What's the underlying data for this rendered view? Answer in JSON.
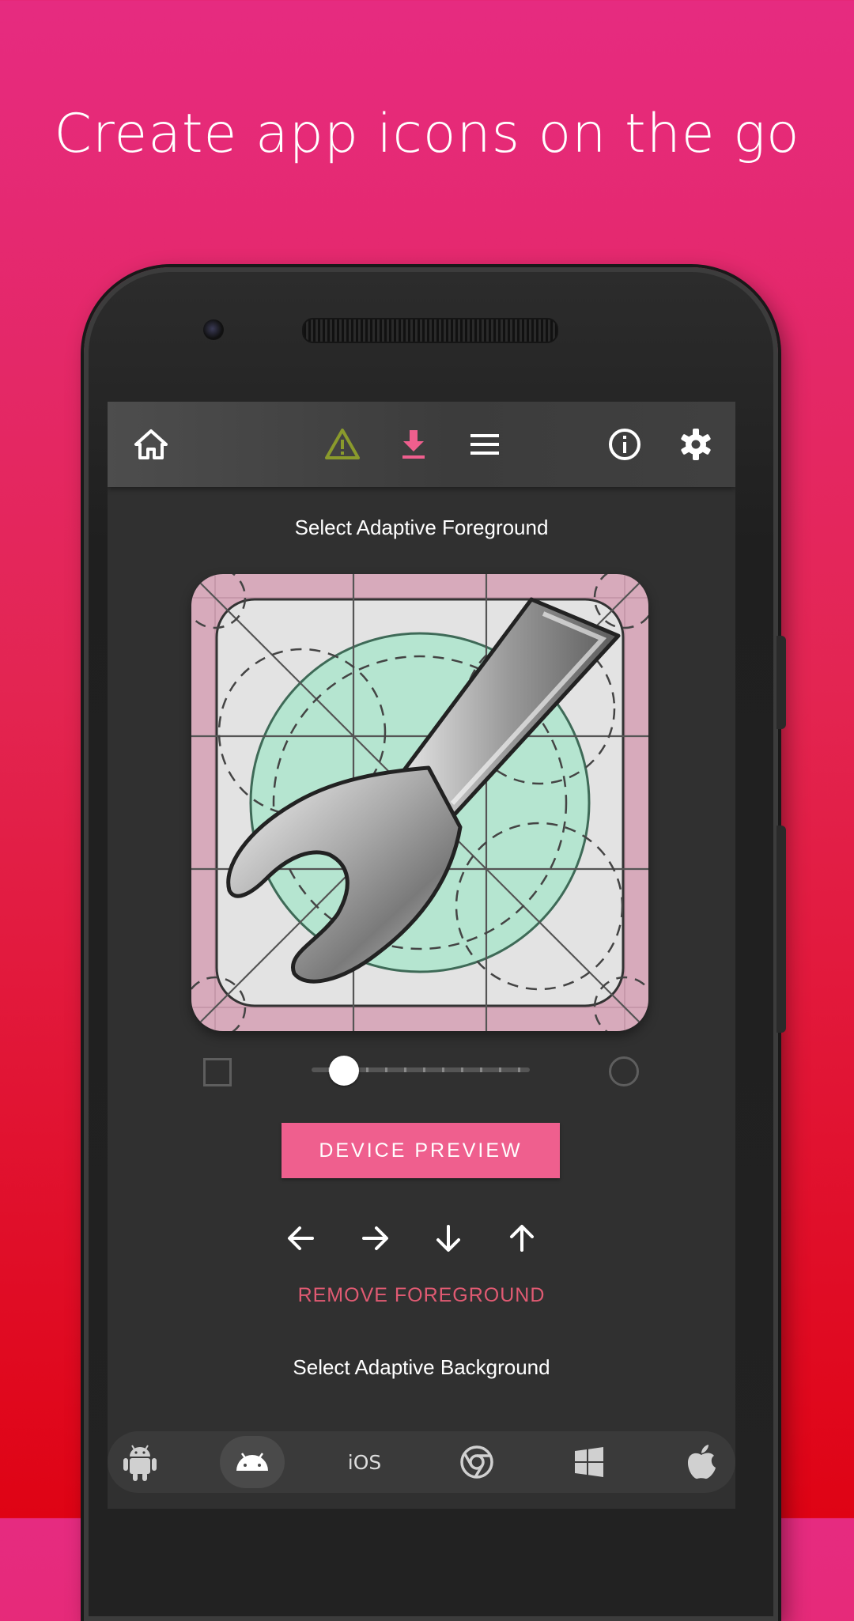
{
  "headline": "Create app icons on the go",
  "toolbar": {
    "icons": [
      "home-icon",
      "warning-icon",
      "download-icon",
      "menu-icon",
      "info-icon",
      "settings-icon"
    ],
    "colors": {
      "warning": "#8a9a2c",
      "download": "#ef5f8e",
      "default": "#ffffff"
    }
  },
  "foreground": {
    "title": "Select Adaptive Foreground",
    "shape_options": [
      "square-icon",
      "circle-icon"
    ],
    "corner_slider": {
      "value": 0.15
    }
  },
  "buttons": {
    "device_preview": "DEVICE PREVIEW",
    "remove_foreground": "REMOVE FOREGROUND"
  },
  "arrows": [
    "arrow-left-icon",
    "arrow-right-icon",
    "arrow-down-icon",
    "arrow-up-icon"
  ],
  "background": {
    "title": "Select Adaptive Background"
  },
  "platforms": {
    "items": [
      "android-legacy-icon",
      "android-adaptive-icon",
      "ios",
      "chrome-icon",
      "windows-icon",
      "apple-icon"
    ],
    "ios_label": "iOS",
    "selected": "android-adaptive-icon"
  },
  "accent_color": "#ef5f8e"
}
